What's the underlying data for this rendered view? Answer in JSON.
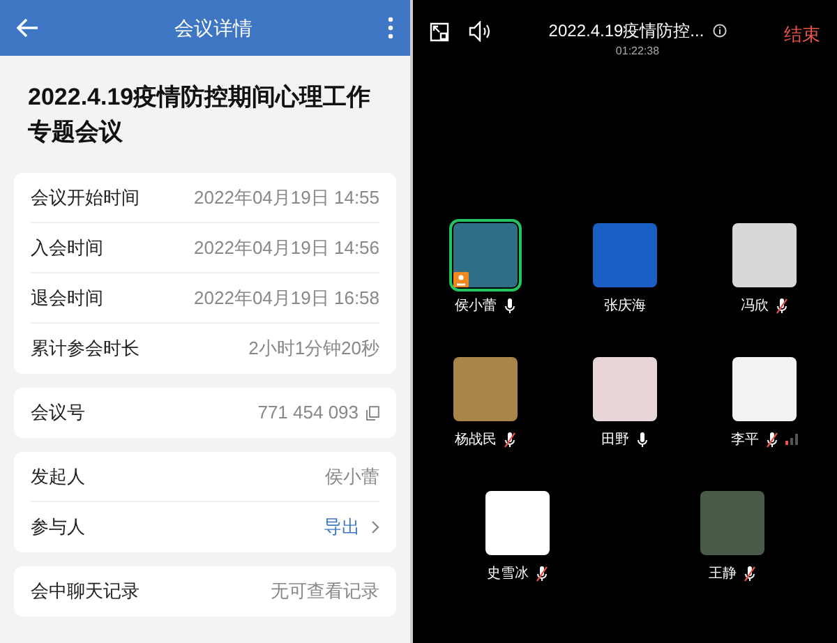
{
  "details": {
    "header": {
      "title": "会议详情"
    },
    "meeting_title": "2022.4.19疫情防控期间心理工作专题会议",
    "groups": [
      {
        "rows": [
          {
            "label": "会议开始时间",
            "value": "2022年04月19日 14:55"
          },
          {
            "label": "入会时间",
            "value": "2022年04月19日 14:56"
          },
          {
            "label": "退会时间",
            "value": "2022年04月19日 16:58"
          },
          {
            "label": "累计参会时长",
            "value": "2小时1分钟20秒"
          }
        ]
      },
      {
        "rows": [
          {
            "label": "会议号",
            "value": "771 454 093",
            "kind": "copy"
          }
        ]
      },
      {
        "rows": [
          {
            "label": "发起人",
            "value": "侯小蕾"
          },
          {
            "label": "参与人",
            "value": "导出",
            "kind": "link"
          }
        ]
      },
      {
        "rows": [
          {
            "label": "会中聊天记录",
            "value": "无可查看记录"
          }
        ]
      }
    ]
  },
  "meeting": {
    "title": "2022.4.19疫情防控...",
    "timer": "01:22:38",
    "end_button": "结束",
    "participant_rows": [
      [
        {
          "name": "侯小蕾",
          "mic_icon": true,
          "muted": false,
          "speaking": true,
          "host": true,
          "signal": false
        },
        {
          "name": "张庆海",
          "mic_icon": false,
          "speaking": false,
          "host": false,
          "signal": false
        },
        {
          "name": "冯欣",
          "mic_icon": true,
          "muted": true,
          "speaking": false,
          "host": false,
          "signal": false
        }
      ],
      [
        {
          "name": "杨战民",
          "mic_icon": true,
          "muted": true,
          "speaking": false,
          "host": false,
          "signal": false
        },
        {
          "name": "田野",
          "mic_icon": true,
          "muted": false,
          "speaking": false,
          "host": false,
          "signal": false
        },
        {
          "name": "李平",
          "mic_icon": true,
          "muted": true,
          "speaking": false,
          "host": false,
          "signal": true
        }
      ],
      [
        {
          "name": "史雪冰",
          "mic_icon": true,
          "muted": true,
          "speaking": false,
          "host": false,
          "signal": false
        },
        {
          "name": "王静",
          "mic_icon": true,
          "muted": true,
          "speaking": false,
          "host": false,
          "signal": false
        }
      ]
    ]
  }
}
